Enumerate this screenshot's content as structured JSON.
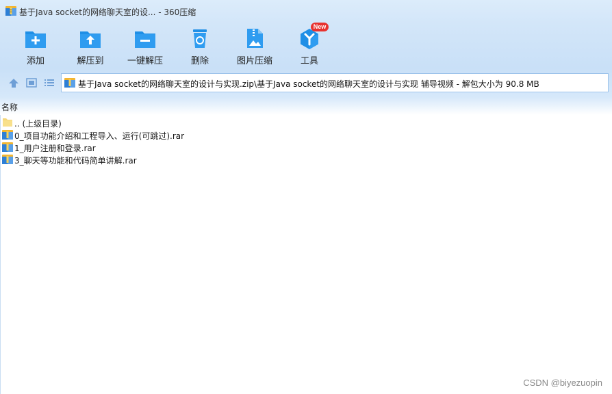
{
  "window": {
    "title": "基于Java socket的网络聊天室的设... - 360压缩"
  },
  "toolbar": {
    "items": [
      {
        "label": "添加",
        "icon": "add-folder-icon"
      },
      {
        "label": "解压到",
        "icon": "extract-to-icon"
      },
      {
        "label": "一键解压",
        "icon": "one-click-extract-icon"
      },
      {
        "label": "删除",
        "icon": "trash-icon"
      },
      {
        "label": "图片压缩",
        "icon": "image-compress-icon"
      },
      {
        "label": "工具",
        "icon": "tools-icon"
      }
    ],
    "new_badge": "New"
  },
  "nav": {
    "address": "基于Java socket的网络聊天室的设计与实现.zip\\基于Java socket的网络聊天室的设计与实现 辅导视频 - 解包大小为 90.8 MB"
  },
  "list": {
    "column_name": "名称",
    "rows": [
      {
        "name": ".. (上级目录)",
        "icon": "parent-folder-icon"
      },
      {
        "name": "0_项目功能介绍和工程导入、运行(可跳过).rar",
        "icon": "rar-archive-icon"
      },
      {
        "name": "1_用户注册和登录.rar",
        "icon": "rar-archive-icon"
      },
      {
        "name": "3_聊天等功能和代码简单讲解.rar",
        "icon": "rar-archive-icon"
      }
    ]
  },
  "watermark": "CSDN @biyezuopin",
  "colors": {
    "accent": "#1f8fe6",
    "badge": "#e8322f"
  }
}
